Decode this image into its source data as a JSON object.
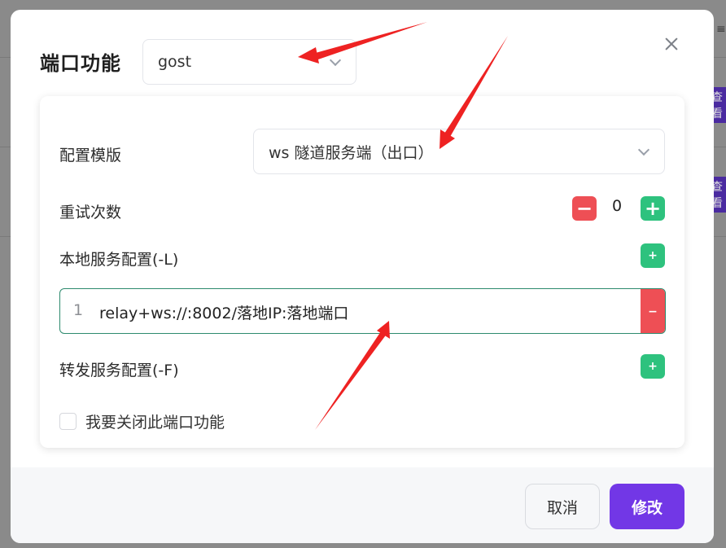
{
  "background": {
    "button_label_1": "查看",
    "button_label_2": "查看",
    "menu_glyph": "≡"
  },
  "modal": {
    "title": "端口功能",
    "function_select": {
      "value": "gost"
    },
    "template": {
      "label": "配置模版",
      "value": "ws 隧道服务端（出口）"
    },
    "retry": {
      "label": "重试次数",
      "value": "0",
      "minus": "−",
      "plus": "+"
    },
    "local_service": {
      "label": "本地服务配置(-L)",
      "add": "+",
      "lines": [
        {
          "no": "1",
          "text": "relay+ws://:8002/落地IP:落地端口",
          "remove": "−"
        }
      ]
    },
    "forward_service": {
      "label": "转发服务配置(-F)",
      "add": "+"
    },
    "disable_checkbox": {
      "label": "我要关闭此端口功能",
      "checked": false
    },
    "footer": {
      "cancel_label": "取消",
      "ok_label": "修改"
    }
  },
  "colors": {
    "accent": "#7237e6",
    "danger": "#ee4f55",
    "success": "#2ec27e",
    "annotation_arrow": "#ee2222"
  }
}
